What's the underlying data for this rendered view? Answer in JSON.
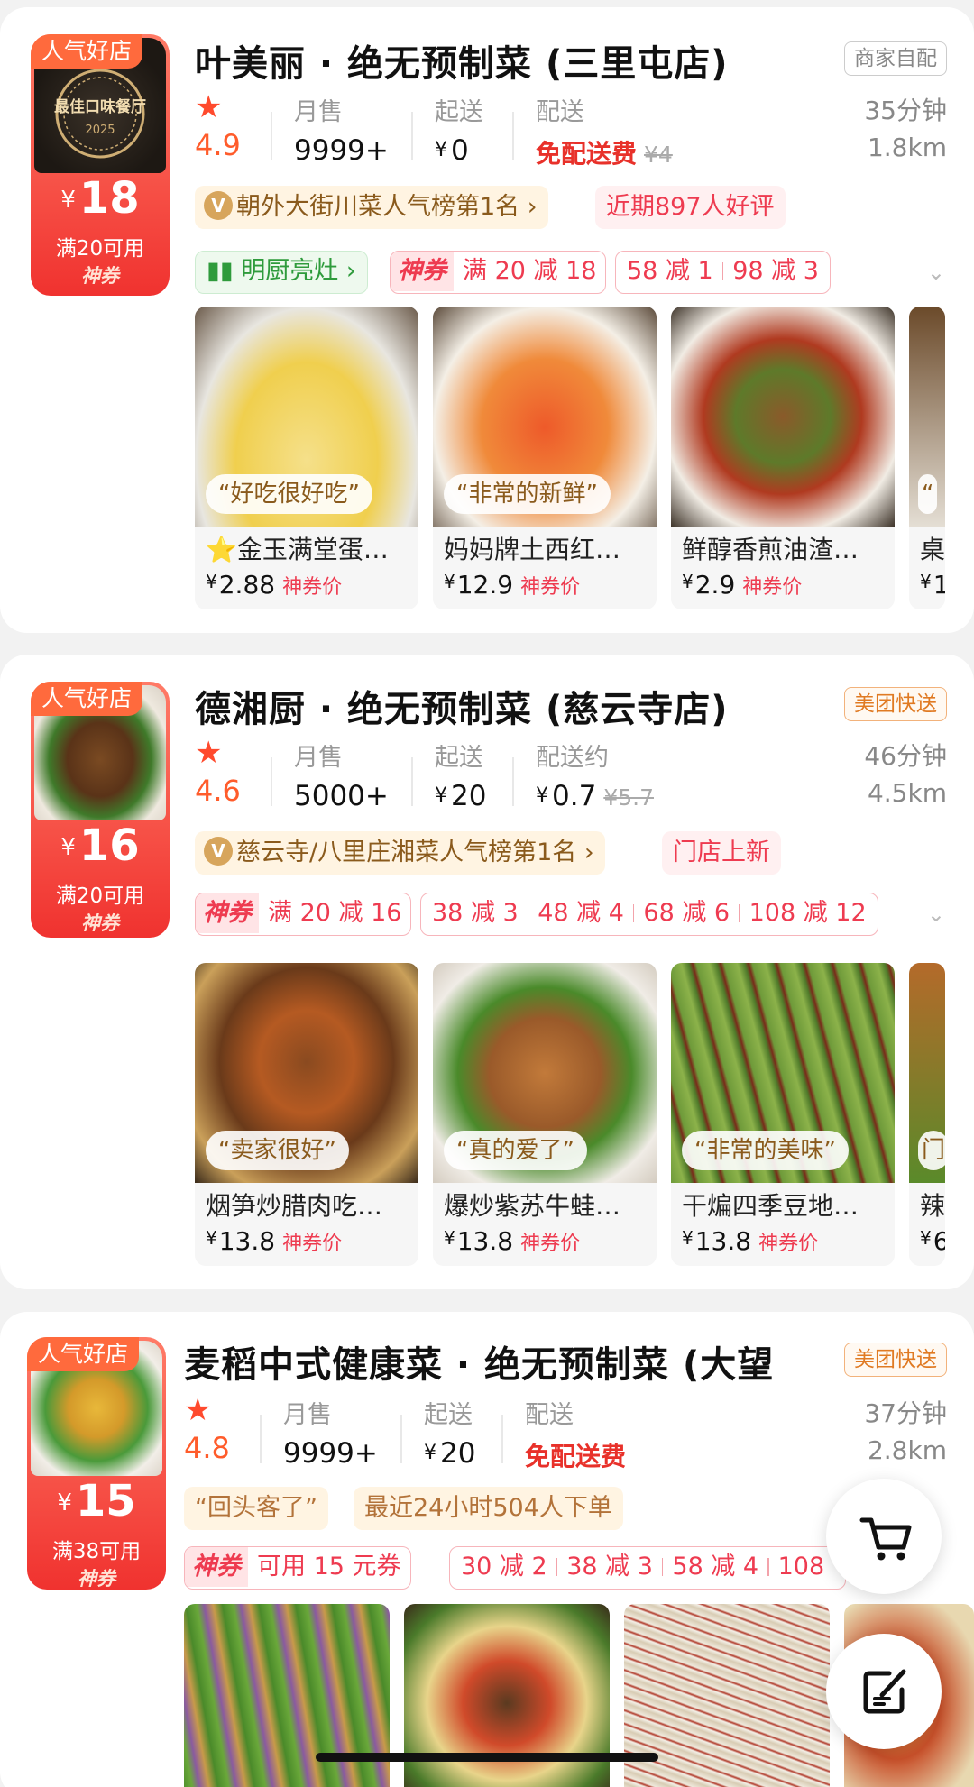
{
  "stores": [
    {
      "tag": "人气好店",
      "coupon_amount": "18",
      "coupon_condition": "满20可用",
      "coupon_god": "神券",
      "logo_text": "最佳口味餐厅",
      "name": "叶美丽 · 绝无预制菜 (三里屯店)",
      "delivery_type": "商家自配",
      "rating": "4.9",
      "sales_label": "月售",
      "sales": "9999+",
      "min_label": "起送",
      "min_order": "0",
      "fee_label": "配送",
      "fee": "免配送费",
      "fee_original": "¥4",
      "time": "35分钟",
      "distance": "1.8km",
      "rank": "朝外大街川菜人气榜第1名 ›",
      "badge": "近期897人好评",
      "kitchen": "明厨亮灶 ›",
      "god_coupon": "满 20 减 18",
      "discounts": [
        "58 减 1",
        "98 减 3"
      ],
      "dishes": [
        {
          "quote": "“好吃很好吃”",
          "name": "⭐金玉满堂蛋…",
          "price": "2.88",
          "price_label": "神券价"
        },
        {
          "quote": "“非常的新鲜”",
          "name": "妈妈牌土西红…",
          "price": "12.9",
          "price_label": "神券价"
        },
        {
          "quote": "",
          "name": "鲜醇香煎油渣…",
          "price": "2.9",
          "price_label": "神券价"
        },
        {
          "quote": "“",
          "name": "桌",
          "price": "1",
          "price_label": ""
        }
      ]
    },
    {
      "tag": "人气好店",
      "coupon_amount": "16",
      "coupon_condition": "满20可用",
      "coupon_god": "神券",
      "name": "德湘厨 · 绝无预制菜 (慈云寺店)",
      "delivery_type": "美团快送",
      "rating": "4.6",
      "sales_label": "月售",
      "sales": "5000+",
      "min_label": "起送",
      "min_order": "20",
      "fee_label": "配送约",
      "fee": "0.7",
      "fee_original": "¥5.7",
      "time": "46分钟",
      "distance": "4.5km",
      "rank": "慈云寺/八里庄湘菜人气榜第1名 ›",
      "badge": "门店上新",
      "god_coupon": "满 20 减 16",
      "discounts": [
        "38 减 3",
        "48 减 4",
        "68 减 6",
        "108 减 12"
      ],
      "dishes": [
        {
          "quote": "“卖家很好”",
          "name": "烟笋炒腊肉吃…",
          "price": "13.8",
          "price_label": "神券价"
        },
        {
          "quote": "“真的爱了”",
          "name": "爆炒紫苏牛蛙…",
          "price": "13.8",
          "price_label": "神券价"
        },
        {
          "quote": "“非常的美味”",
          "name": "干煸四季豆地…",
          "price": "13.8",
          "price_label": "神券价"
        },
        {
          "quote": "门",
          "name": "辣",
          "price": "6",
          "price_label": ""
        }
      ]
    },
    {
      "tag": "人气好店",
      "coupon_amount": "15",
      "coupon_condition": "满38可用",
      "coupon_god": "神券",
      "name": "麦稻中式健康菜 · 绝无预制菜 (大望",
      "delivery_type": "美团快送",
      "rating": "4.8",
      "sales_label": "月售",
      "sales": "9999+",
      "min_label": "起送",
      "min_order": "20",
      "fee_label": "配送",
      "fee": "免配送费",
      "time": "37分钟",
      "distance": "2.8km",
      "quote_chip": "“回头客了”",
      "badge": "最近24小时504人下单",
      "god_coupon": "可用 15 元券",
      "discounts": [
        "30 减 2",
        "38 减 3",
        "58 减 4",
        "108"
      ]
    }
  ],
  "icons": [
    "star-icon",
    "medal-icon",
    "chart-icon",
    "cart-icon",
    "edit-icon",
    "chevron-down-icon"
  ]
}
